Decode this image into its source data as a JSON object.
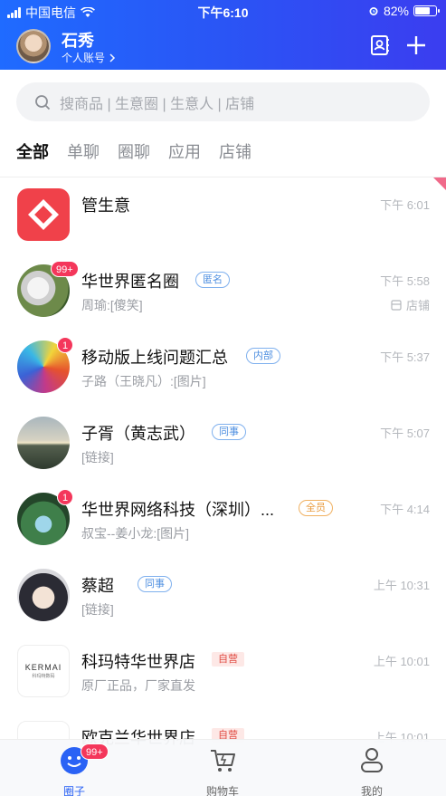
{
  "status": {
    "carrier": "中国电信",
    "time": "下午6:10",
    "battery": "82%",
    "battery_level": 0.82
  },
  "header": {
    "user_name": "石秀",
    "account_label": "个人账号",
    "icons": [
      "contacts-icon",
      "plus-icon"
    ]
  },
  "search": {
    "placeholder": "搜商品 | 生意圈 | 生意人 | 店铺"
  },
  "tabs": [
    {
      "label": "全部",
      "active": true
    },
    {
      "label": "单聊",
      "active": false
    },
    {
      "label": "圈聊",
      "active": false
    },
    {
      "label": "应用",
      "active": false
    },
    {
      "label": "店铺",
      "active": false
    }
  ],
  "conversations": [
    {
      "title": "管生意",
      "subtitle": "",
      "time": "下午 6:01"
    },
    {
      "title": "华世界匿名圈",
      "tag": "匿名",
      "subtitle": "周瑜:[傻笑]",
      "time": "下午 5:58",
      "badge": "99+",
      "store": "店铺"
    },
    {
      "title": "移动版上线问题汇总",
      "tag": "内部",
      "subtitle": "子路（王晓凡）:[图片]",
      "time": "下午 5:37",
      "badge": "1"
    },
    {
      "title": "子胥（黄志武）",
      "tag": "同事",
      "subtitle": "[链接]",
      "time": "下午 5:07"
    },
    {
      "title": "华世界网络科技（深圳）...",
      "tag": "全员",
      "subtitle": "叔宝--姜小龙:[图片]",
      "time": "下午 4:14",
      "badge": "1"
    },
    {
      "title": "蔡超",
      "tag": "同事",
      "subtitle": "[链接]",
      "time": "上午 10:31"
    },
    {
      "title": "科玛特华世界店",
      "tag": "自营",
      "subtitle": "原厂正品，厂家直发",
      "time": "上午 10:01",
      "logo_text": "KERMAI",
      "logo_sub": "科玛特数码"
    },
    {
      "title": "欧克兰华世界店",
      "tag": "自营",
      "subtitle": "",
      "time": "上午 10:01"
    }
  ],
  "tabbar": [
    {
      "label": "圈子",
      "badge": "99+",
      "active": true
    },
    {
      "label": "购物车",
      "active": false
    },
    {
      "label": "我的",
      "active": false
    }
  ],
  "colors": {
    "header_start": "#1f6bff",
    "header_end": "#3b3df0",
    "accent": "#2a62f5",
    "badge": "#f4375b"
  }
}
